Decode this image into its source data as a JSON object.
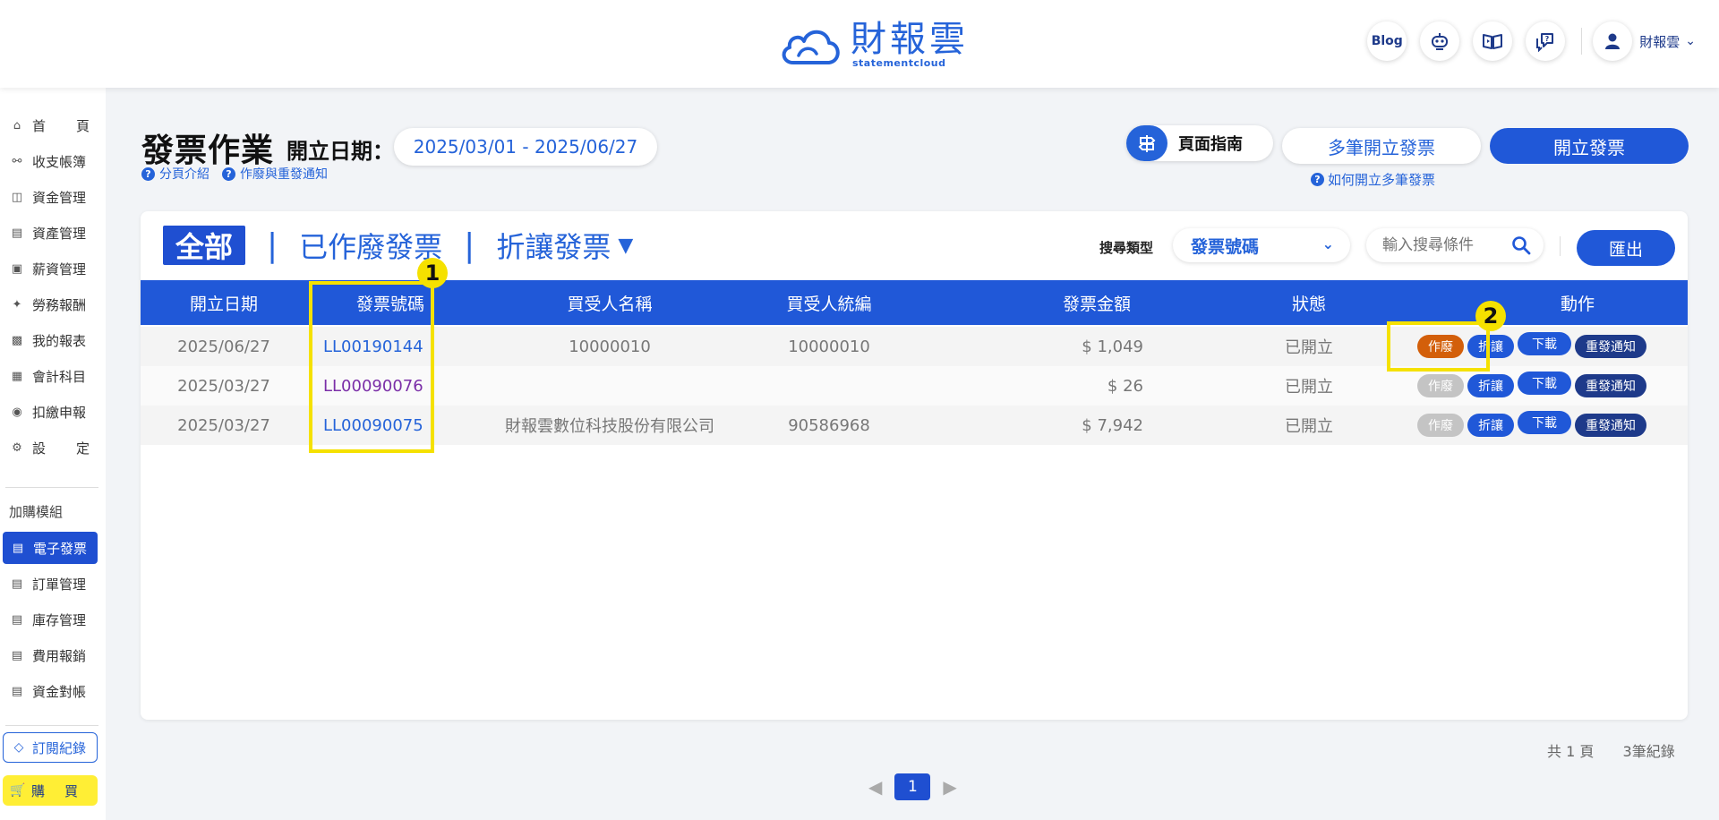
{
  "header": {
    "logo_cn": "財報雲",
    "logo_en": "statementcloud",
    "blog_label": "Blog",
    "user_name": "財報雲"
  },
  "sidebar": {
    "items": [
      {
        "label": "首頁",
        "icon": "home-icon"
      },
      {
        "label": "收支帳簿",
        "icon": "coin-icon"
      },
      {
        "label": "資金管理",
        "icon": "funds-icon"
      },
      {
        "label": "資產管理",
        "icon": "asset-icon"
      },
      {
        "label": "薪資管理",
        "icon": "salary-icon"
      },
      {
        "label": "勞務報酬",
        "icon": "labor-icon"
      },
      {
        "label": "我的報表",
        "icon": "report-icon"
      },
      {
        "label": "會計科目",
        "icon": "ledger-icon"
      },
      {
        "label": "扣繳申報",
        "icon": "withholding-icon"
      },
      {
        "label": "設定",
        "icon": "settings-icon"
      }
    ],
    "addon_title": "加購模組",
    "addons": [
      {
        "label": "電子發票",
        "active": true
      },
      {
        "label": "訂單管理"
      },
      {
        "label": "庫存管理"
      },
      {
        "label": "費用報銷"
      },
      {
        "label": "資金對帳"
      }
    ],
    "subscription_label": "訂閱紀錄",
    "buy_label": "購買"
  },
  "page": {
    "title": "發票作業",
    "date_label": "開立日期：",
    "date_range": "2025/03/01 - 2025/06/27",
    "help_intro": "分頁介紹",
    "help_void": "作廢與重發通知",
    "guide_label": "頁面指南",
    "multi_issue_label": "多筆開立發票",
    "issue_label": "開立發票",
    "multi_help": "如何開立多筆發票"
  },
  "tabs": {
    "all": "全部",
    "voided": "已作廢發票",
    "allowance": "折讓發票"
  },
  "search": {
    "type_label": "搜尋類型",
    "type_value": "發票號碼",
    "placeholder": "輸入搜尋條件",
    "export_label": "匯出"
  },
  "table": {
    "headers": [
      "開立日期",
      "發票號碼",
      "買受人名稱",
      "買受人統編",
      "發票金額",
      "狀態",
      "動作"
    ],
    "rows": [
      {
        "date": "2025/06/27",
        "number": "LL00190144",
        "buyer": "10000010",
        "tax_id": "10000010",
        "amount": "$ 1,049",
        "status": "已開立",
        "void_enabled": true
      },
      {
        "date": "2025/03/27",
        "number": "LL00090076",
        "buyer": "",
        "tax_id": "",
        "amount": "$ 26",
        "status": "已開立",
        "void_enabled": false
      },
      {
        "date": "2025/03/27",
        "number": "LL00090075",
        "buyer": "財報雲數位科技股份有限公司",
        "tax_id": "90586968",
        "amount": "$ 7,942",
        "status": "已開立",
        "void_enabled": false
      }
    ],
    "actions": {
      "void": "作廢",
      "allowance": "折讓",
      "download": "下載",
      "resend": "重發通知"
    }
  },
  "annotations": {
    "badge1": "1",
    "badge2": "2"
  },
  "footer": {
    "total_pages": "共 1 頁",
    "total_records": "3筆紀錄",
    "current_page": "1"
  },
  "colors": {
    "primary": "#2058d8",
    "void": "#d35f0a",
    "highlight": "#f5e100",
    "buy": "#ffee35"
  }
}
